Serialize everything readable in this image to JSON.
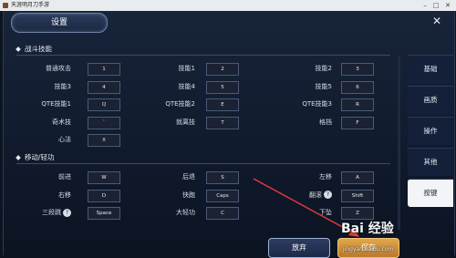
{
  "window": {
    "title": "天涯明月刀手游"
  },
  "header": {
    "title": "设置"
  },
  "sections": {
    "combat": "战斗技能",
    "move": "移动/轻功"
  },
  "combat_rows": [
    [
      {
        "label": "普通攻击",
        "key": "1"
      },
      {
        "label": "技能1",
        "key": "2"
      },
      {
        "label": "技能2",
        "key": "3"
      }
    ],
    [
      {
        "label": "技能3",
        "key": "4"
      },
      {
        "label": "技能4",
        "key": "5"
      },
      {
        "label": "技能5",
        "key": "6"
      }
    ],
    [
      {
        "label": "QTE技能1",
        "key": "Q"
      },
      {
        "label": "QTE技能2",
        "key": "E"
      },
      {
        "label": "QTE技能3",
        "key": "R"
      }
    ],
    [
      {
        "label": "奇术技",
        "key": "`"
      },
      {
        "label": "就离技",
        "key": "T"
      },
      {
        "label": "格挡",
        "key": "F"
      }
    ],
    [
      {
        "label": "心法",
        "key": "X"
      }
    ]
  ],
  "move_rows": [
    [
      {
        "label": "前进",
        "key": "W"
      },
      {
        "label": "后退",
        "key": "S"
      },
      {
        "label": "左移",
        "key": "A"
      }
    ],
    [
      {
        "label": "右移",
        "key": "D"
      },
      {
        "label": "快跑",
        "key": "Caps"
      },
      {
        "label": "翻滚",
        "key": "Shift",
        "help": "?"
      }
    ],
    [
      {
        "label": "三段跳",
        "key": "Space",
        "help": "?"
      },
      {
        "label": "大轻功",
        "key": "C"
      },
      {
        "label": "下坠",
        "key": "Z"
      }
    ]
  ],
  "side_menu": [
    "基础",
    "画质",
    "操作",
    "其他",
    "按键"
  ],
  "buttons": {
    "cancel": "放弃",
    "save": "保存"
  },
  "watermark": {
    "brand": "Bai 经验",
    "url": "jingyan.baidu.com"
  },
  "colors": {
    "accent": "#e0a84a",
    "active_tab": "#f2f4f7",
    "bg": "#101a2c"
  }
}
